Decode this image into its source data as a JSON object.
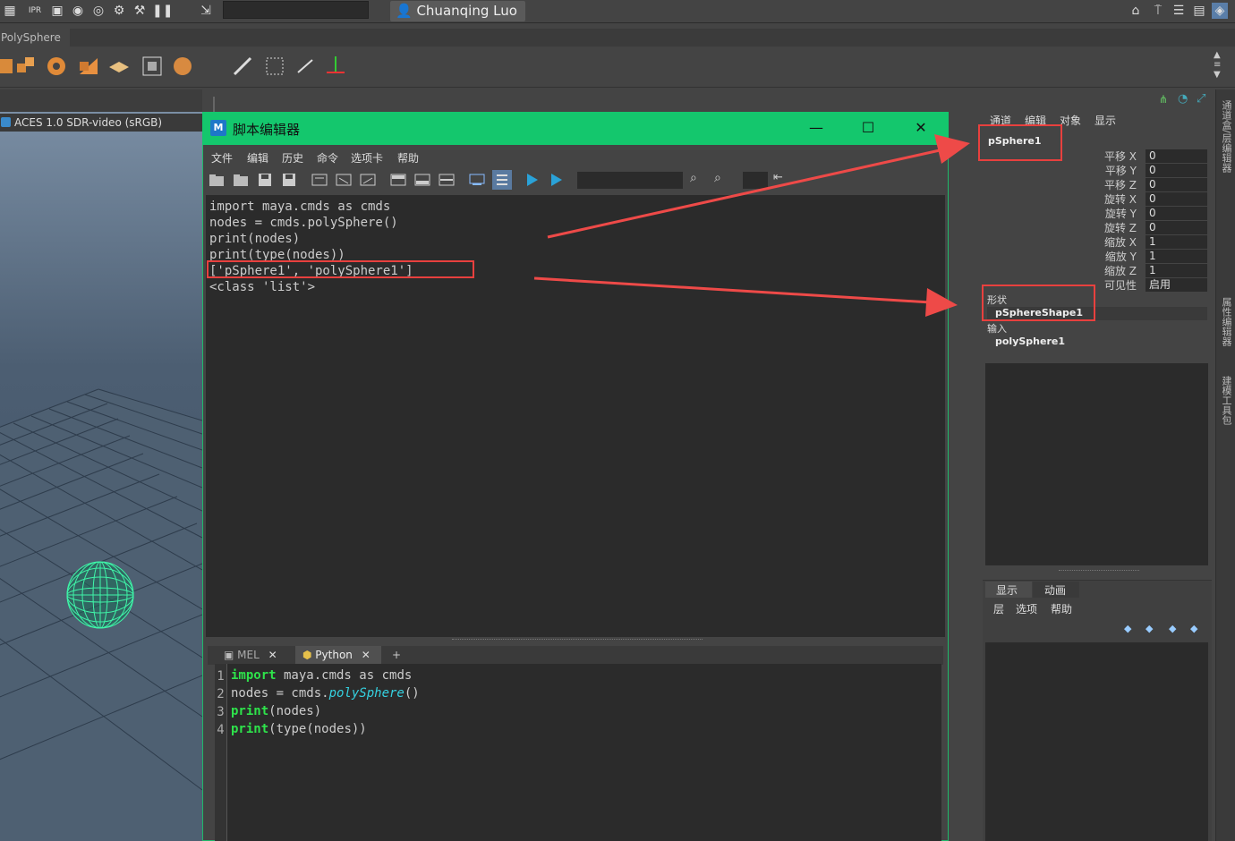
{
  "topbar": {
    "user": "Chuanqing Luo ▾",
    "ipr_label": "IPR"
  },
  "shelf": {
    "tab_label": "PolySphere"
  },
  "viewport": {
    "color_space": "ACES 1.0 SDR-video (sRGB)"
  },
  "script_editor": {
    "title": "脚本编辑器",
    "logo": "M",
    "menu": [
      "文件",
      "编辑",
      "历史",
      "命令",
      "选项卡",
      "帮助"
    ],
    "output_lines": [
      "import maya.cmds as cmds",
      "nodes = cmds.polySphere()",
      "print(nodes)",
      "print(type(nodes))",
      "['pSphere1', 'polySphere1']",
      "<class 'list'>"
    ],
    "tabs": [
      {
        "label": "MEL",
        "close": "✕"
      },
      {
        "label": "Python",
        "close": "✕"
      },
      {
        "label": "+",
        "close": ""
      }
    ],
    "line_numbers": [
      "1",
      "2",
      "3",
      "4"
    ],
    "input_code": {
      "l1_kw": "import",
      "l1_rest": " maya.cmds as cmds",
      "l2_pre": "nodes = cmds.",
      "l2_fn": "polySphere",
      "l2_post": "()",
      "l3_kw": "print",
      "l3_rest": "(nodes)",
      "l4_kw": "print",
      "l4_rest": "(type(nodes))"
    }
  },
  "channel_box": {
    "menu": [
      "通道",
      "编辑",
      "对象",
      "显示"
    ],
    "object_name": "pSphere1",
    "attributes": [
      {
        "label": "平移 X",
        "value": "0"
      },
      {
        "label": "平移 Y",
        "value": "0"
      },
      {
        "label": "平移 Z",
        "value": "0"
      },
      {
        "label": "旋转 X",
        "value": "0"
      },
      {
        "label": "旋转 Y",
        "value": "0"
      },
      {
        "label": "旋转 Z",
        "value": "0"
      },
      {
        "label": "缩放 X",
        "value": "1"
      },
      {
        "label": "缩放 Y",
        "value": "1"
      },
      {
        "label": "缩放 Z",
        "value": "1"
      },
      {
        "label": "可见性",
        "value": "启用"
      }
    ],
    "shapes_label": "形状",
    "shape_name": "pSphereShape1",
    "inputs_label": "输入",
    "input_name": "polySphere1"
  },
  "layer_editor": {
    "tabs": [
      "显示",
      "动画"
    ],
    "menu": [
      "层",
      "选项",
      "帮助"
    ]
  },
  "side_tabs": [
    "通道盒/层编辑器",
    "属性编辑器",
    "建模工具包"
  ]
}
